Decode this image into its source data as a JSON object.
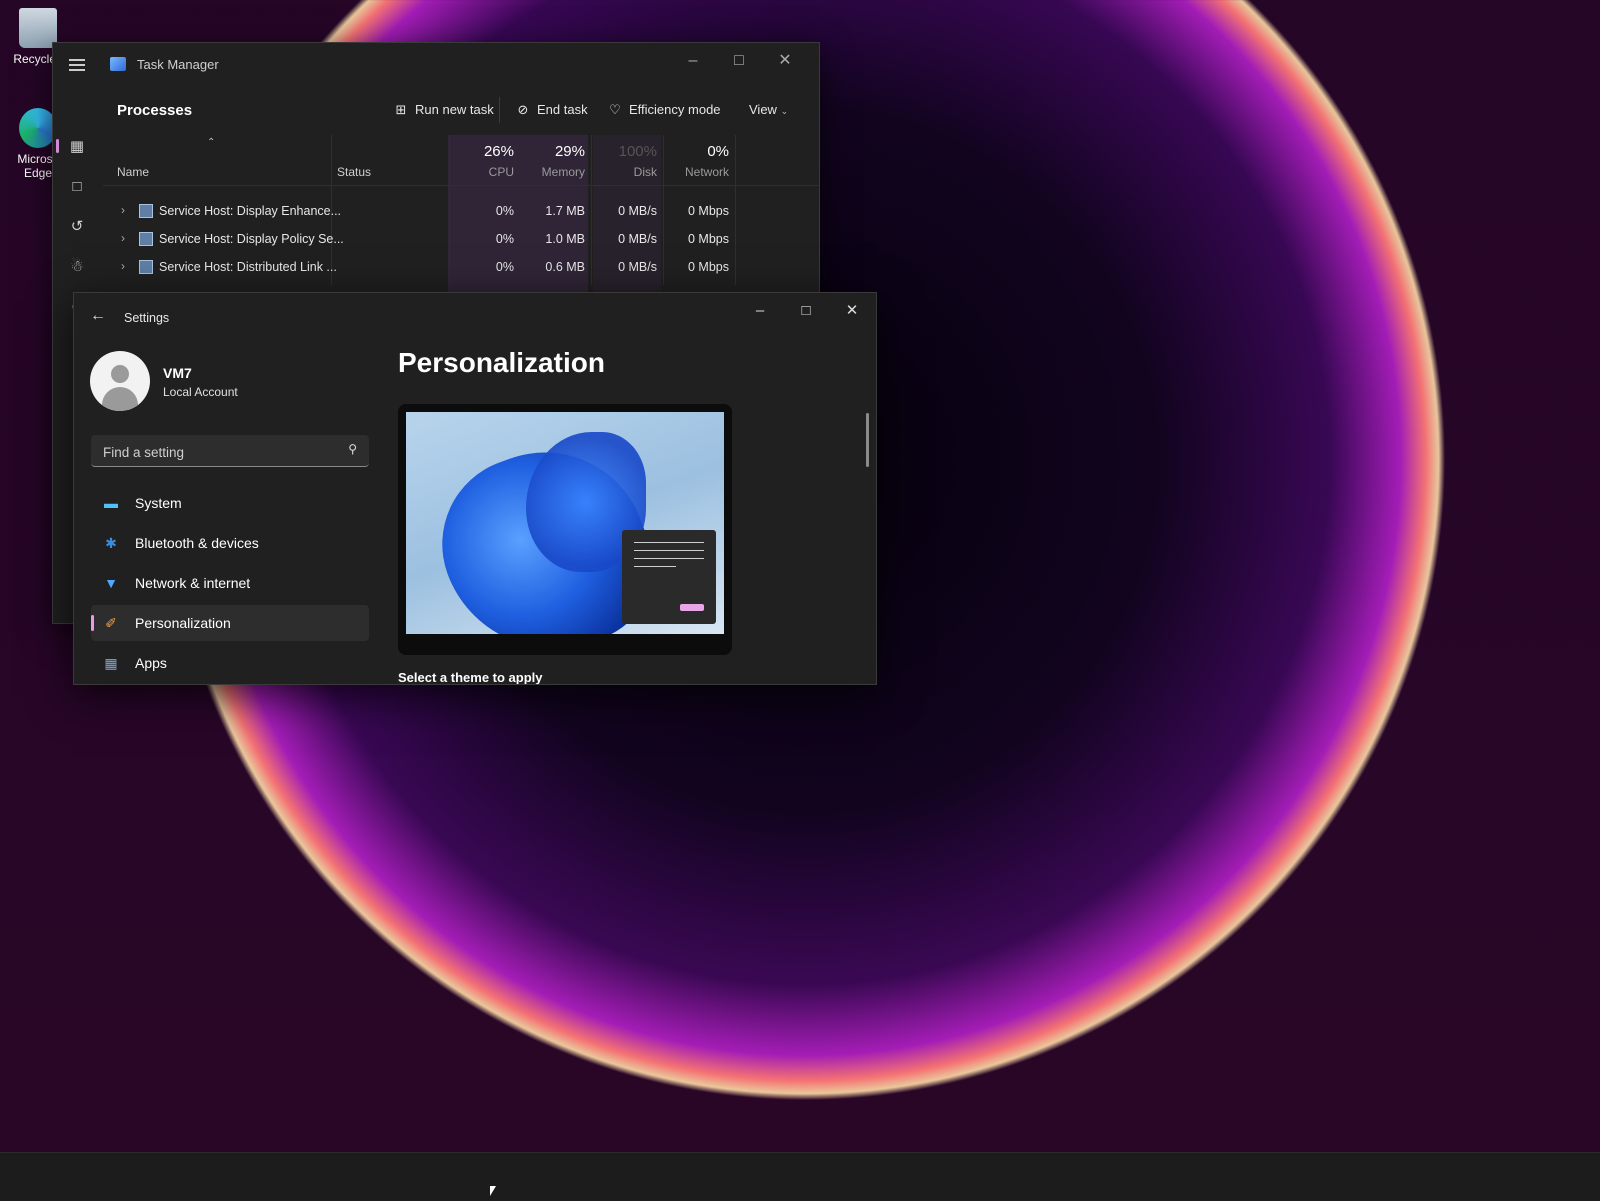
{
  "desktop": {
    "icons": [
      {
        "label": "Recycle I",
        "icon": "recycle-bin-icon"
      },
      {
        "label": "Microsc\nEdge",
        "icon": "edge-icon"
      }
    ]
  },
  "task_manager": {
    "title": "Task Manager",
    "heading": "Processes",
    "toolbar": {
      "run_new_task": "Run new task",
      "end_task": "End task",
      "efficiency_mode": "Efficiency mode",
      "view": "View"
    },
    "columns": {
      "name": "Name",
      "status": "Status",
      "cpu_pct": "26%",
      "cpu": "CPU",
      "memory_pct": "29%",
      "memory": "Memory",
      "disk_pct": "100%",
      "disk": "Disk",
      "network_pct": "0%",
      "network": "Network"
    },
    "rows": [
      {
        "name": "Service Host: Display Enhance...",
        "cpu": "0%",
        "memory": "1.7 MB",
        "disk": "0 MB/s",
        "network": "0 Mbps"
      },
      {
        "name": "Service Host: Display Policy Se...",
        "cpu": "0%",
        "memory": "1.0 MB",
        "disk": "0 MB/s",
        "network": "0 Mbps"
      },
      {
        "name": "Service Host: Distributed Link ...",
        "cpu": "0%",
        "memory": "0.6 MB",
        "disk": "0 MB/s",
        "network": "0 Mbps"
      }
    ]
  },
  "settings": {
    "title": "Settings",
    "user": {
      "name": "VM7",
      "account": "Local Account"
    },
    "search": {
      "placeholder": "Find a setting"
    },
    "nav": [
      {
        "label": "System",
        "icon": "monitor-icon"
      },
      {
        "label": "Bluetooth & devices",
        "icon": "bluetooth-icon"
      },
      {
        "label": "Network & internet",
        "icon": "wifi-icon"
      },
      {
        "label": "Personalization",
        "icon": "paintbrush-icon",
        "active": true
      },
      {
        "label": "Apps",
        "icon": "apps-icon"
      }
    ],
    "page_title": "Personalization",
    "section_heading": "Select a theme to apply"
  }
}
